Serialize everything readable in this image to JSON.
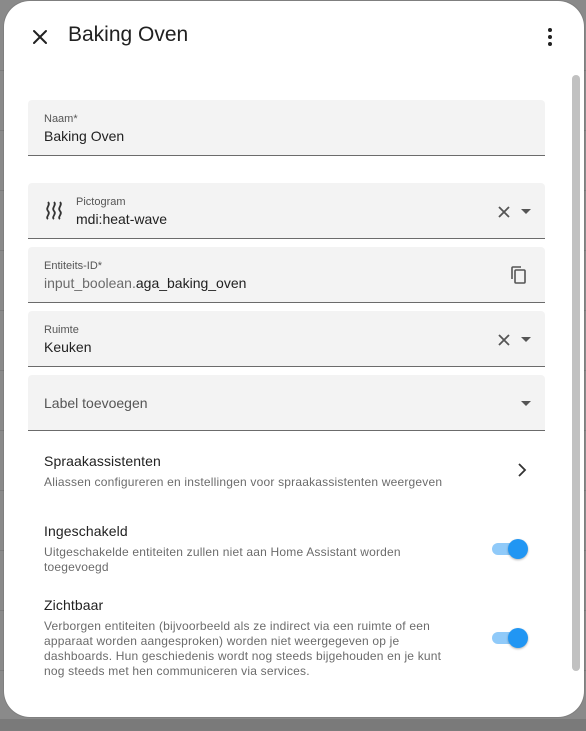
{
  "dialog": {
    "title": "Baking Oven"
  },
  "fields": {
    "name": {
      "label": "Naam*",
      "value": "Baking Oven"
    },
    "icon": {
      "label": "Pictogram",
      "value": "mdi:heat-wave",
      "icon_name": "heat-wave-icon"
    },
    "entity_id": {
      "label": "Entiteits-ID*",
      "prefix": "input_boolean.",
      "value": "aga_baking_oven"
    },
    "area": {
      "label": "Ruimte",
      "value": "Keuken"
    },
    "labels": {
      "placeholder": "Label toevoegen"
    }
  },
  "voice_assistants": {
    "title": "Spraakassistenten",
    "description": "Aliassen configureren en instellingen voor spraakassistenten weergeven"
  },
  "enabled": {
    "title": "Ingeschakeld",
    "description": "Uitgeschakelde entiteiten zullen niet aan Home Assistant worden toegevoegd",
    "on": true
  },
  "visible": {
    "title": "Zichtbaar",
    "description": "Verborgen entiteiten (bijvoorbeeld als ze indirect via een ruimte of een apparaat worden aangesproken) worden niet weergegeven op je dashboards. Hun geschiedenis wordt nog steeds bijgehouden en je kunt nog steeds met hen communiceren via services.",
    "on": true
  },
  "colors": {
    "accent": "#2196f3",
    "accent_track": "#90caf9",
    "field_bg": "#f3f3f3"
  }
}
